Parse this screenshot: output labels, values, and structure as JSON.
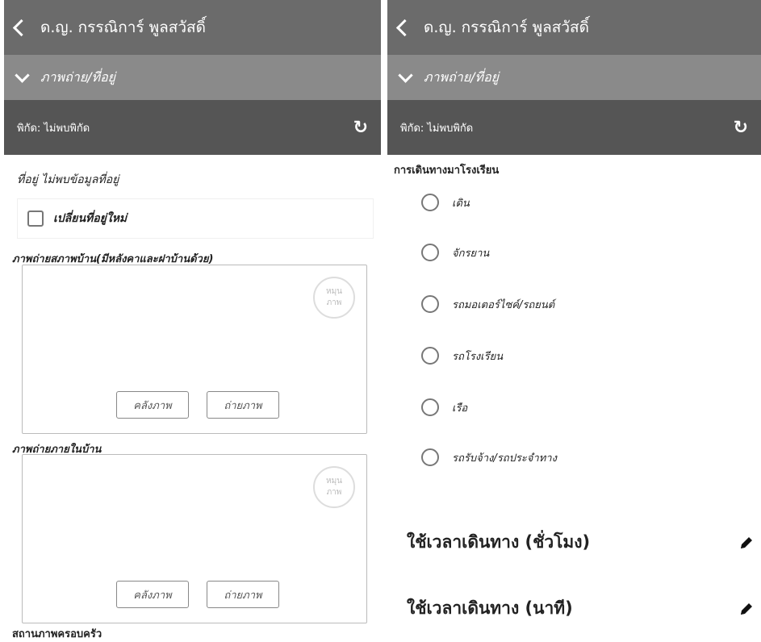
{
  "left": {
    "header_title": "ด.ญ. กรรณิการ์ พูลสวัสดิ์",
    "section_title": "ภาพถ่าย/ที่อยู่",
    "coords_label": "พิกัด: ไม่พบพิกัด",
    "address_text": "ที่อยู่ ไม่พบข้อมูลที่อยู่",
    "change_address_label": "เปลี่ยนที่อยู่ใหม่",
    "house_photo_title": "ภาพถ่ายสภาพบ้าน(มีหลังคาและฝาบ้านด้วย)",
    "inside_photo_title": "ภาพถ่ายภายในบ้าน",
    "family_status_title": "สถานภาพครอบครัว",
    "rotate_line1": "หมุน",
    "rotate_line2": "ภาพ",
    "gallery_button": "คลังภาพ",
    "camera_button": "ถ่ายภาพ"
  },
  "right": {
    "header_title": "ด.ญ. กรรณิการ์ พูลสวัสดิ์",
    "section_title": "ภาพถ่าย/ที่อยู่",
    "coords_label": "พิกัด: ไม่พบพิกัด",
    "travel_title": "การเดินทางมาโรงเรียน",
    "options": [
      "เดิน",
      "จักรยาน",
      "รถมอเตอร์ไซค์/รถยนต์",
      "รถโรงเรียน",
      "เรือ",
      "รถรับจ้าง/รถประจำทาง"
    ],
    "time_hours_label": "ใช้เวลาเดินทาง (ชั่วโมง)",
    "time_minutes_label": "ใช้เวลาเดินทาง (นาที)"
  },
  "colors": {
    "header_dark": "#6b6b6b",
    "header_mid": "#8a8a8a",
    "header_coords": "#555555"
  },
  "icons": [
    "back-chevron-icon",
    "expand-chevron-icon",
    "refresh-icon",
    "pencil-icon"
  ]
}
